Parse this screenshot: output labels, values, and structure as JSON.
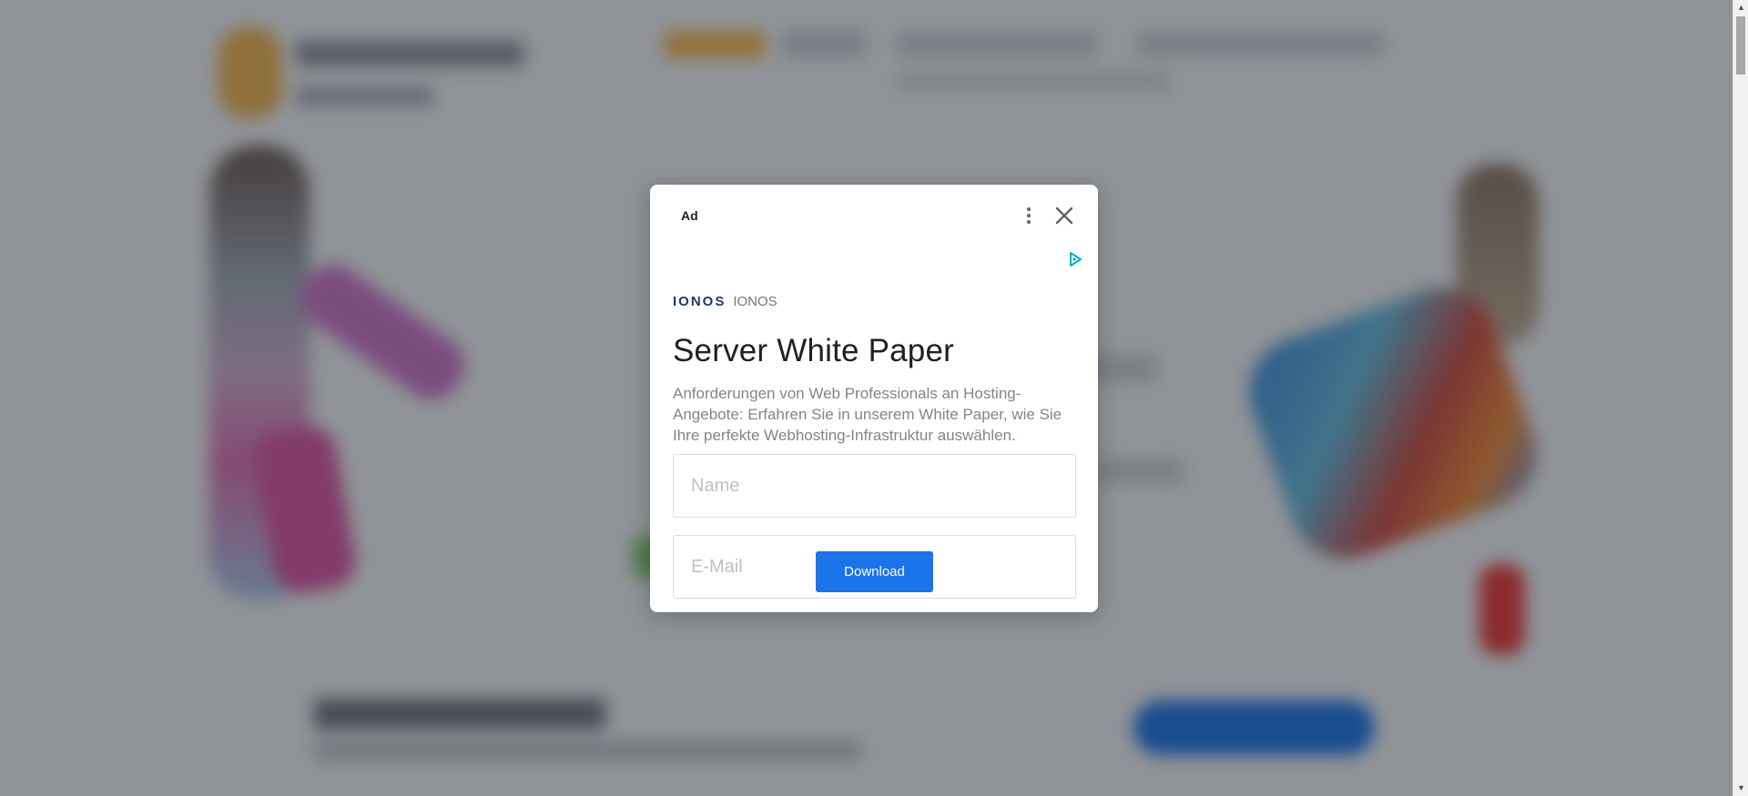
{
  "ad": {
    "label": "Ad",
    "menu_icon": "more-vert-icon",
    "close_icon": "close-icon",
    "adchoices_icon": "adchoices-icon",
    "brand_logo": "IONOS",
    "brand_name": "IONOS",
    "title": "Server White Paper",
    "description": "Anforderungen von Web Professionals an Hosting-Angebote: Erfahren Sie in unserem White Paper, wie Sie Ihre perfekte Webhosting-Infrastruktur auswählen.",
    "name_placeholder": "Name",
    "email_placeholder": "E-Mail",
    "download_label": "Download",
    "accent_color": "#1a73e8",
    "adchoices_color": "#00aecd",
    "brand_color": "#1b3a66"
  },
  "scrollbar": {
    "up_icon": "scroll-up-arrow",
    "down_icon": "scroll-down-arrow"
  }
}
